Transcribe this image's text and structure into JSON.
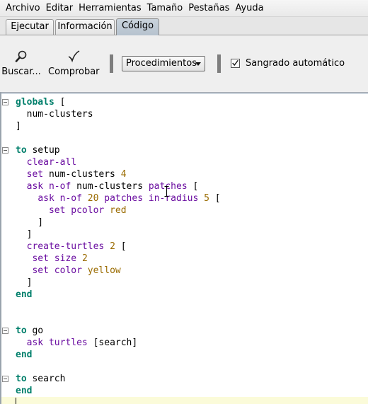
{
  "menubar": {
    "items": [
      {
        "label": "Archivo"
      },
      {
        "label": "Editar"
      },
      {
        "label": "Herramientas"
      },
      {
        "label": "Tamaño"
      },
      {
        "label": "Pestañas"
      },
      {
        "label": "Ayuda"
      }
    ]
  },
  "tabs": [
    {
      "label": "Ejecutar",
      "active": false
    },
    {
      "label": "Información",
      "active": false
    },
    {
      "label": "Código",
      "active": true
    }
  ],
  "toolbar": {
    "find_label": "Buscar...",
    "find_icon": "magnifier-icon",
    "check_label": "Comprobar",
    "check_icon": "checkmark-icon",
    "procedures_label": "Procedimientos",
    "auto_indent_label": "Sangrado automático",
    "auto_indent_checked": true
  },
  "colors": {
    "keyword": "#007f6b",
    "primitive": "#6a0da0",
    "constant": "#9a6b00",
    "current_line": "#fbfbd9"
  },
  "code": {
    "lines": [
      [
        {
          "t": "globals",
          "c": "kw"
        },
        {
          "t": " [",
          "c": ""
        }
      ],
      [
        {
          "t": "  num-clusters",
          "c": ""
        }
      ],
      [
        {
          "t": "]",
          "c": ""
        }
      ],
      [],
      [
        {
          "t": "to",
          "c": "kw"
        },
        {
          "t": " setup",
          "c": ""
        }
      ],
      [
        {
          "t": "  ",
          "c": ""
        },
        {
          "t": "clear-all",
          "c": "prim"
        }
      ],
      [
        {
          "t": "  ",
          "c": ""
        },
        {
          "t": "set",
          "c": "prim"
        },
        {
          "t": " num-clusters ",
          "c": ""
        },
        {
          "t": "4",
          "c": "num"
        }
      ],
      [
        {
          "t": "  ",
          "c": ""
        },
        {
          "t": "ask",
          "c": "prim"
        },
        {
          "t": " ",
          "c": ""
        },
        {
          "t": "n-of",
          "c": "prim"
        },
        {
          "t": " num-clusters ",
          "c": ""
        },
        {
          "t": "patches",
          "c": "prim"
        },
        {
          "t": " [",
          "c": ""
        }
      ],
      [
        {
          "t": "    ",
          "c": ""
        },
        {
          "t": "ask",
          "c": "prim"
        },
        {
          "t": " ",
          "c": ""
        },
        {
          "t": "n-of",
          "c": "prim"
        },
        {
          "t": " ",
          "c": ""
        },
        {
          "t": "20",
          "c": "num"
        },
        {
          "t": " ",
          "c": ""
        },
        {
          "t": "patches",
          "c": "prim"
        },
        {
          "t": " ",
          "c": ""
        },
        {
          "t": "in-radius",
          "c": "prim"
        },
        {
          "t": " ",
          "c": ""
        },
        {
          "t": "5",
          "c": "num"
        },
        {
          "t": " [",
          "c": ""
        }
      ],
      [
        {
          "t": "      ",
          "c": ""
        },
        {
          "t": "set",
          "c": "prim"
        },
        {
          "t": " ",
          "c": ""
        },
        {
          "t": "pcolor",
          "c": "prim"
        },
        {
          "t": " ",
          "c": ""
        },
        {
          "t": "red",
          "c": "clr"
        }
      ],
      [
        {
          "t": "    ]",
          "c": ""
        }
      ],
      [
        {
          "t": "  ]",
          "c": ""
        }
      ],
      [
        {
          "t": "  ",
          "c": ""
        },
        {
          "t": "create-turtles",
          "c": "prim"
        },
        {
          "t": " ",
          "c": ""
        },
        {
          "t": "2",
          "c": "num"
        },
        {
          "t": " [",
          "c": ""
        }
      ],
      [
        {
          "t": "   ",
          "c": ""
        },
        {
          "t": "set",
          "c": "prim"
        },
        {
          "t": " ",
          "c": ""
        },
        {
          "t": "size",
          "c": "prim"
        },
        {
          "t": " ",
          "c": ""
        },
        {
          "t": "2",
          "c": "num"
        }
      ],
      [
        {
          "t": "   ",
          "c": ""
        },
        {
          "t": "set",
          "c": "prim"
        },
        {
          "t": " ",
          "c": ""
        },
        {
          "t": "color",
          "c": "prim"
        },
        {
          "t": " ",
          "c": ""
        },
        {
          "t": "yellow",
          "c": "clr"
        }
      ],
      [
        {
          "t": "  ]",
          "c": ""
        }
      ],
      [
        {
          "t": "end",
          "c": "kw"
        }
      ],
      [],
      [],
      [
        {
          "t": "to",
          "c": "kw"
        },
        {
          "t": " go",
          "c": ""
        }
      ],
      [
        {
          "t": "  ",
          "c": ""
        },
        {
          "t": "ask",
          "c": "prim"
        },
        {
          "t": " ",
          "c": ""
        },
        {
          "t": "turtles",
          "c": "prim"
        },
        {
          "t": " [search]",
          "c": ""
        }
      ],
      [
        {
          "t": "end",
          "c": "kw"
        }
      ],
      [],
      [
        {
          "t": "to",
          "c": "kw"
        },
        {
          "t": " search",
          "c": ""
        }
      ],
      [
        {
          "t": "end",
          "c": "kw"
        }
      ],
      []
    ],
    "folds": [
      0,
      4,
      19,
      23
    ]
  }
}
